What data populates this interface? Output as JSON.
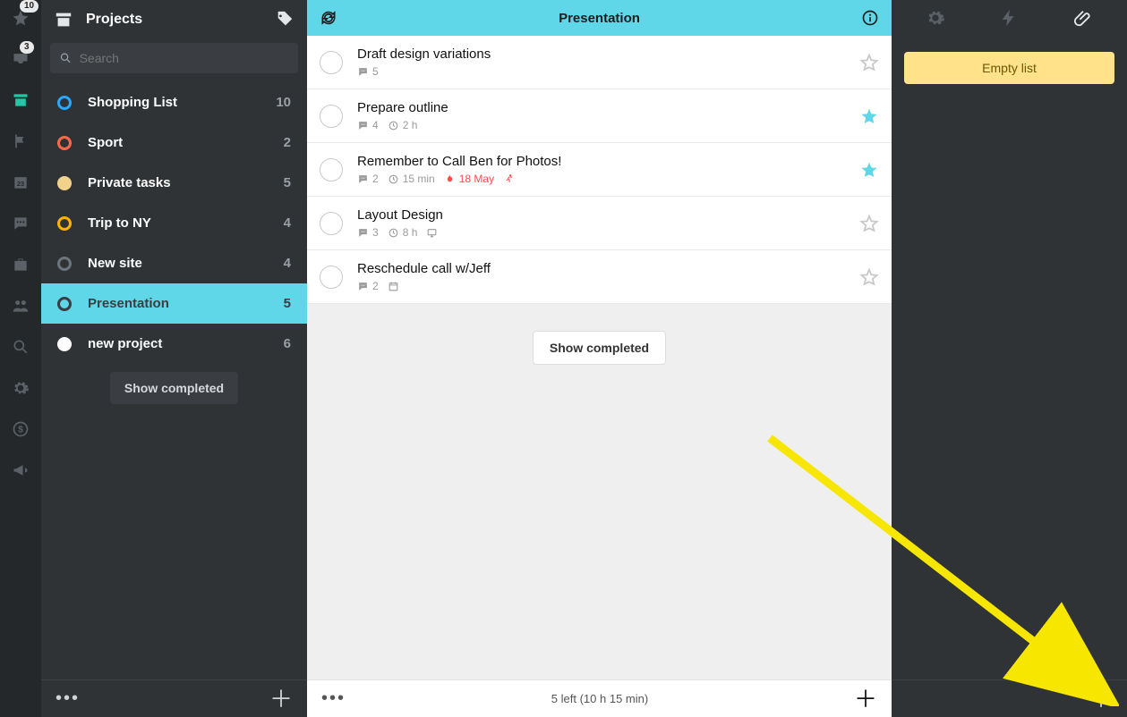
{
  "rail": {
    "items": [
      {
        "name": "star-icon",
        "badge": "10"
      },
      {
        "name": "inbox-icon",
        "badge": "3"
      },
      {
        "name": "archive-icon",
        "active": true
      },
      {
        "name": "flag-icon"
      },
      {
        "name": "calendar-icon",
        "glyph": "23"
      },
      {
        "name": "chat-icon"
      },
      {
        "name": "briefcase-icon"
      },
      {
        "name": "people-icon"
      },
      {
        "name": "search-icon"
      },
      {
        "name": "gear-icon"
      },
      {
        "name": "dollar-icon"
      },
      {
        "name": "megaphone-icon"
      }
    ]
  },
  "sidebar": {
    "title": "Projects",
    "search_placeholder": "Search",
    "projects": [
      {
        "name": "Shopping List",
        "count": "10",
        "color": "#2aa7ff",
        "style": "ring"
      },
      {
        "name": "Sport",
        "count": "2",
        "color": "#ff6a4d",
        "style": "ring"
      },
      {
        "name": "Private tasks",
        "count": "5",
        "color": "#f0d28a",
        "style": "filled"
      },
      {
        "name": "Trip to NY",
        "count": "4",
        "color": "#ffb300",
        "style": "ring"
      },
      {
        "name": "New site",
        "count": "4",
        "color": "#6c757d",
        "style": "ring"
      },
      {
        "name": "Presentation",
        "count": "5",
        "color": "#3a3e42",
        "style": "ring",
        "selected": true
      },
      {
        "name": "new project",
        "count": "6",
        "color": "#ffffff",
        "style": "filled"
      }
    ],
    "show_completed_label": "Show completed"
  },
  "main": {
    "title": "Presentation",
    "tasks": [
      {
        "title": "Draft design variations",
        "comments": "5",
        "starred": false
      },
      {
        "title": "Prepare outline",
        "comments": "4",
        "time": "2 h",
        "starred": true
      },
      {
        "title": "Remember to Call Ben for Photos!",
        "comments": "2",
        "time": "15 min",
        "due": "18 May",
        "priority": true,
        "starred": true
      },
      {
        "title": "Layout Design",
        "comments": "3",
        "time": "8 h",
        "screen": true,
        "starred": false
      },
      {
        "title": "Reschedule call w/Jeff",
        "comments": "2",
        "calendar": true,
        "starred": false
      }
    ],
    "show_completed_label": "Show completed",
    "footer_status": "5 left (10 h 15 min)"
  },
  "detail": {
    "empty_label": "Empty list"
  }
}
